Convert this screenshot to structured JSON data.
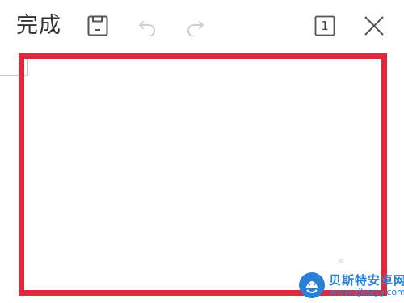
{
  "toolbar": {
    "done_label": "完成",
    "page_number": "1",
    "icons": {
      "save": "save-icon",
      "undo": "undo-icon",
      "redo": "redo-icon",
      "page": "page-count-icon",
      "close": "close-icon"
    }
  },
  "canvas": {
    "highlight_color": "#e1283c",
    "faint_mark": "∞"
  },
  "watermark": {
    "title": "贝斯特安卓网",
    "url": "www.zjbstyy.com",
    "color": "#2a7fd6"
  }
}
